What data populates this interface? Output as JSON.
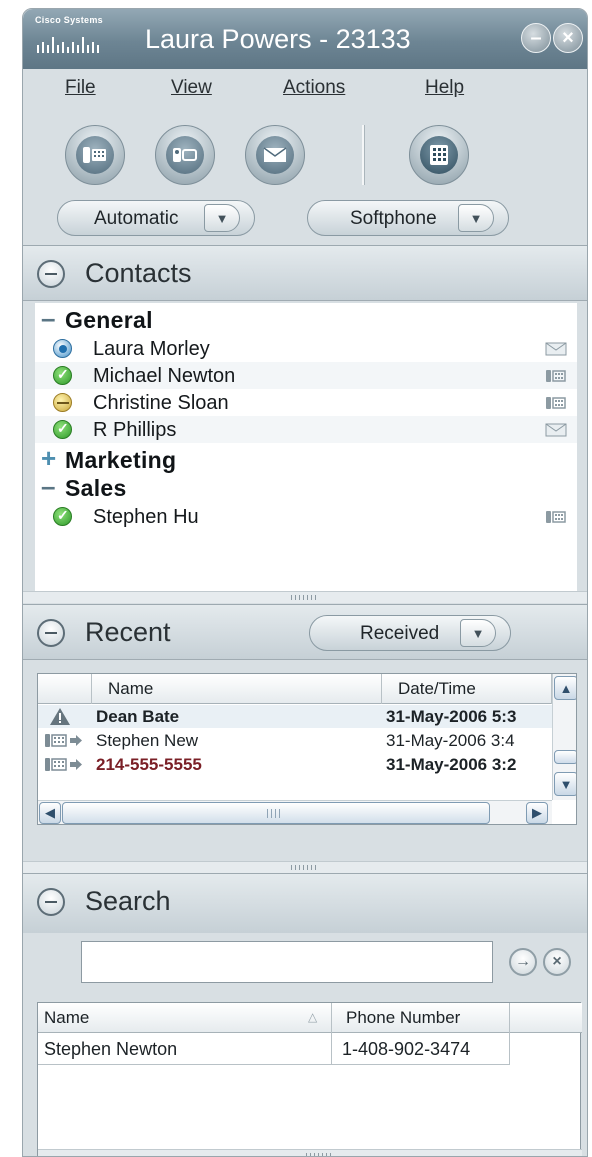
{
  "window": {
    "brand": "Cisco Systems",
    "title": "Laura Powers - 23133"
  },
  "menu": {
    "file": "File",
    "view": "View",
    "actions": "Actions",
    "help": "Help"
  },
  "toolbar": {
    "mode_label": "Automatic",
    "device_label": "Softphone"
  },
  "contacts": {
    "title": "Contacts",
    "general": "General",
    "marketing": "Marketing",
    "sales": "Sales",
    "items": [
      {
        "name": "Laura Morley",
        "status": "idle",
        "action": "mail-icon"
      },
      {
        "name": "Michael Newton",
        "status": "online",
        "action": "phone-icon"
      },
      {
        "name": "Christine Sloan",
        "status": "busy",
        "action": "phone-icon"
      },
      {
        "name": "R Phillips",
        "status": "online",
        "action": "mail-icon"
      },
      {
        "name": "Stephen Hu",
        "status": "online",
        "action": "phone-icon"
      }
    ]
  },
  "recent": {
    "title": "Recent",
    "filter_label": "Received",
    "columns": {
      "name": "Name",
      "datetime": "Date/Time"
    },
    "rows": [
      {
        "name": "Dean Bate",
        "datetime": "31-May-2006 5:3",
        "type": "missed-alert"
      },
      {
        "name": "Stephen New",
        "datetime": "31-May-2006 3:4",
        "type": "call-in"
      },
      {
        "name": "214-555-5555",
        "datetime": "31-May-2006 3:2",
        "type": "call-in-missed"
      }
    ]
  },
  "search": {
    "title": "Search",
    "placeholder": "",
    "columns": {
      "name": "Name",
      "phone": "Phone Number"
    },
    "rows": [
      {
        "name": "Stephen Newton",
        "phone": "1-408-902-3474"
      }
    ]
  },
  "colors": {
    "titlebar": "#6d8594",
    "panel": "#d8dfe3",
    "missed": "#7a1f26",
    "online": "#2f9a2a"
  }
}
